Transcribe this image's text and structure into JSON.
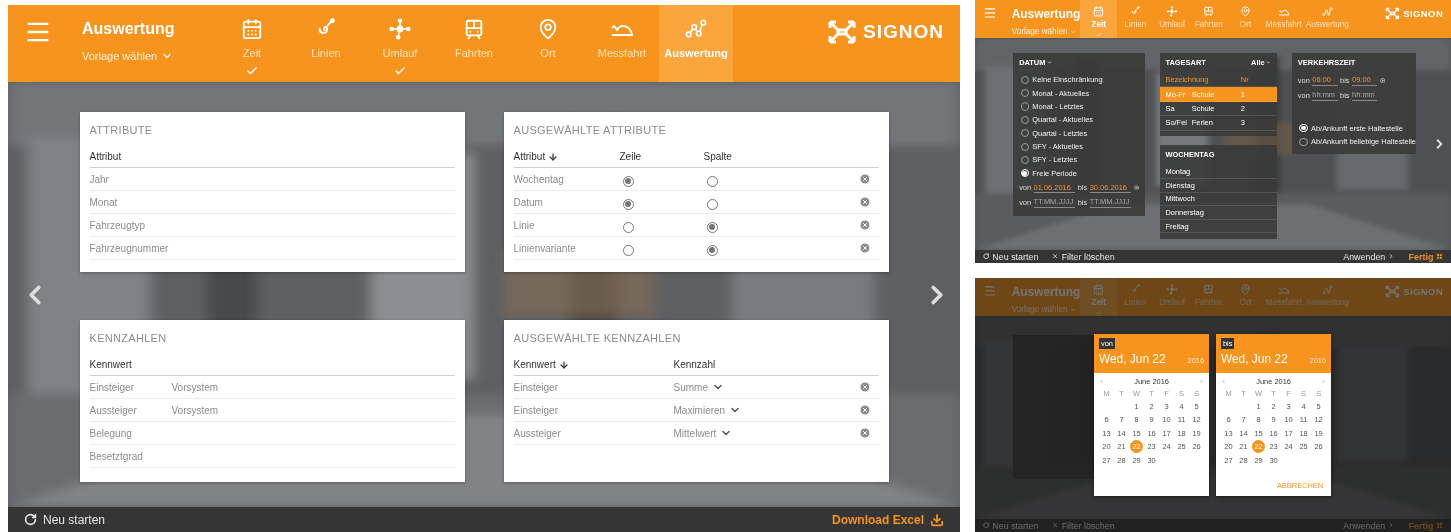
{
  "main": {
    "header": {
      "title": "Auswertung",
      "template": "Vorlage wählen",
      "logo": "SIGNON",
      "steps": [
        {
          "label": "Zeit",
          "kind": "calendar",
          "selected": false,
          "done": true
        },
        {
          "label": "Linien",
          "kind": "line",
          "selected": false,
          "done": false
        },
        {
          "label": "Umlauf",
          "kind": "network",
          "selected": false,
          "done": true
        },
        {
          "label": "Fahrten",
          "kind": "tram",
          "selected": false,
          "done": false
        },
        {
          "label": "Ort",
          "kind": "pin",
          "selected": false,
          "done": false
        },
        {
          "label": "Messfahrt",
          "kind": "hill",
          "selected": false,
          "done": false
        },
        {
          "label": "Auswertung",
          "kind": "graph",
          "selected": true,
          "done": false
        }
      ]
    },
    "attributes": {
      "title": "ATTRIBUTE",
      "column": "Attribut",
      "rows": [
        "Jahr",
        "Monat",
        "Fahrzeugtyp",
        "Fahrzeugnummer"
      ]
    },
    "selected_attributes": {
      "title": "AUSGEWÄHLTE ATTRIBUTE",
      "columns": [
        "Attribut",
        "Zeile",
        "Spalte"
      ],
      "rows": [
        {
          "name": "Wochentag",
          "zeile": true,
          "spalte": false
        },
        {
          "name": "Datum",
          "zeile": true,
          "spalte": false
        },
        {
          "name": "Linie",
          "zeile": false,
          "spalte": true
        },
        {
          "name": "Linienvariante",
          "zeile": false,
          "spalte": true
        }
      ]
    },
    "figures": {
      "title": "KENNZAHLEN",
      "column": "Kennwert",
      "rows": [
        {
          "name": "Einsteiger",
          "source": "Vorsystem"
        },
        {
          "name": "Aussteiger",
          "source": "Vorsystem"
        },
        {
          "name": "Belegung"
        },
        {
          "name": "Besetztgrad"
        }
      ]
    },
    "selected_figures": {
      "title": "AUSGEWÄHLTE KENNZAHLEN",
      "columns": [
        "Kennwert",
        "Kennzahl"
      ],
      "rows": [
        {
          "name": "Einsteiger",
          "measure": "Summe"
        },
        {
          "name": "Einsteiger",
          "measure": "Maximieren"
        },
        {
          "name": "Aussteiger",
          "measure": "Mittelwert"
        }
      ]
    },
    "footer": {
      "left": [
        {
          "label": "Neu starten",
          "kind": "restart",
          "accent": false
        }
      ],
      "right": [
        {
          "label": "Download Excel",
          "kind": "download",
          "accent": true
        }
      ]
    }
  },
  "filter_view": {
    "header": {
      "title": "Auswertung",
      "template": "Vorlage wählen",
      "logo": "SIGNON",
      "steps": [
        {
          "label": "Zeit",
          "kind": "calendar",
          "selected": true,
          "done": true
        },
        {
          "label": "Linien",
          "kind": "line",
          "selected": false,
          "done": false
        },
        {
          "label": "Umlauf",
          "kind": "network",
          "selected": false,
          "done": false
        },
        {
          "label": "Fahrten",
          "kind": "tram",
          "selected": false,
          "done": false
        },
        {
          "label": "Ort",
          "kind": "pin",
          "selected": false,
          "done": false
        },
        {
          "label": "Messfahrt",
          "kind": "hill",
          "selected": false,
          "done": false
        },
        {
          "label": "Auswertung",
          "kind": "graph",
          "selected": false,
          "done": false
        }
      ]
    },
    "datum": {
      "title": "DATUM",
      "options": [
        {
          "label": "Keine Einschränkung",
          "selected": false
        },
        {
          "label": "Monat - Aktuelles",
          "selected": false
        },
        {
          "label": "Monat - Letztes",
          "selected": false
        },
        {
          "label": "Quartal - Aktuelles",
          "selected": false
        },
        {
          "label": "Quartal - Letztes",
          "selected": false
        },
        {
          "label": "SFY - Aktuelles",
          "selected": false
        },
        {
          "label": "SFY - Letztes",
          "selected": false
        },
        {
          "label": "Freie Periode",
          "selected": true
        }
      ],
      "ranges": [
        {
          "from_label": "von",
          "from_value": "01.06.2016",
          "to_label": "bis",
          "to_value": "30.06.2016"
        },
        {
          "from_label": "von",
          "from_placeholder": "TT.MM.JJJJ",
          "to_label": "bis",
          "to_placeholder": "TT.MM.JJJJ"
        }
      ]
    },
    "tagesart": {
      "title": "TAGESART",
      "filter": "Alle",
      "columns": [
        "Bezeichnung",
        "Nr"
      ],
      "rows": [
        {
          "day": "Mo-Fr",
          "type": "Schule",
          "nr": "1",
          "selected": true
        },
        {
          "day": "Sa",
          "type": "Schule",
          "nr": "2",
          "selected": false
        },
        {
          "day": "So/Fei",
          "type": "Ferien",
          "nr": "3",
          "selected": false
        }
      ]
    },
    "wochentag": {
      "title": "WOCHENTAG",
      "rows": [
        "Montag",
        "Dienstag",
        "Mittwoch",
        "Donnerstag",
        "Freitag"
      ]
    },
    "verkehrszeit": {
      "title": "VERKEHRSZEIT",
      "ranges": [
        {
          "from_label": "von",
          "from_value": "06:00",
          "to_label": "bis",
          "to_value": "09:00"
        },
        {
          "from_label": "von",
          "from_placeholder": "hh:mm",
          "to_label": "bis",
          "to_placeholder": "hh:mm"
        }
      ],
      "options": [
        {
          "label": "Ab/Ankunft erste Haltestelle",
          "selected": true
        },
        {
          "label": "Ab/Ankunft beliebige Haltestelle",
          "selected": false
        }
      ]
    },
    "footer": {
      "left": [
        {
          "label": "Neu starten",
          "kind": "restart",
          "accent": false
        },
        {
          "label": "Filter löschen",
          "kind": "clear",
          "accent": false
        }
      ],
      "right": [
        {
          "label": "Anwenden",
          "kind": "next",
          "accent": false
        },
        {
          "label": "Fertig",
          "kind": "done",
          "accent": true
        }
      ]
    }
  },
  "date_view": {
    "header": {
      "title": "Auswertung",
      "template": "Vorlage wählen",
      "logo": "SIGNON",
      "steps": [
        {
          "label": "Zeit",
          "kind": "calendar",
          "selected": true,
          "done": true
        },
        {
          "label": "Linien",
          "kind": "line",
          "selected": false,
          "done": false
        },
        {
          "label": "Umlauf",
          "kind": "network",
          "selected": false,
          "done": false
        },
        {
          "label": "Fahrten",
          "kind": "tram",
          "selected": false,
          "done": false
        },
        {
          "label": "Ort",
          "kind": "pin",
          "selected": false,
          "done": false
        },
        {
          "label": "Messfahrt",
          "kind": "hill",
          "selected": false,
          "done": false
        },
        {
          "label": "Auswertung",
          "kind": "graph",
          "selected": false,
          "done": false
        }
      ]
    },
    "pickers": [
      {
        "tag": "von",
        "date": "Wed, Jun 22",
        "year": "2016",
        "month": "June 2016",
        "weekdays": [
          "M",
          "T",
          "W",
          "T",
          "F",
          "S",
          "S"
        ],
        "weeks": [
          [
            {
              "d": "1",
              "selected": false
            },
            {
              "d": "2",
              "selected": false
            },
            {
              "d": "3",
              "selected": false
            },
            {
              "d": "4",
              "selected": false
            },
            {
              "d": "5",
              "selected": false
            }
          ],
          [
            {
              "d": "6",
              "selected": false
            },
            {
              "d": "7",
              "selected": false
            },
            {
              "d": "8",
              "selected": false
            },
            {
              "d": "9",
              "selected": false
            },
            {
              "d": "10",
              "selected": false
            },
            {
              "d": "11",
              "selected": false
            },
            {
              "d": "12",
              "selected": false
            }
          ],
          [
            {
              "d": "13",
              "selected": false
            },
            {
              "d": "14",
              "selected": false
            },
            {
              "d": "15",
              "selected": false
            },
            {
              "d": "16",
              "selected": false
            },
            {
              "d": "17",
              "selected": false
            },
            {
              "d": "18",
              "selected": false
            },
            {
              "d": "19",
              "selected": false
            }
          ],
          [
            {
              "d": "20",
              "selected": false
            },
            {
              "d": "21",
              "selected": false
            },
            {
              "d": "22",
              "selected": true
            },
            {
              "d": "23",
              "selected": false
            },
            {
              "d": "24",
              "selected": false
            },
            {
              "d": "25",
              "selected": false
            },
            {
              "d": "26",
              "selected": false
            }
          ],
          [
            {
              "d": "27",
              "selected": false
            },
            {
              "d": "28",
              "selected": false
            },
            {
              "d": "29",
              "selected": false
            },
            {
              "d": "30",
              "selected": false
            }
          ]
        ]
      },
      {
        "tag": "bis",
        "date": "Wed, Jun 22",
        "year": "2016",
        "month": "June 2016",
        "weekdays": [
          "M",
          "T",
          "W",
          "T",
          "F",
          "S",
          "S"
        ],
        "action": "ABBRECHEN",
        "weeks": [
          [
            {
              "d": "1",
              "selected": false
            },
            {
              "d": "2",
              "selected": false
            },
            {
              "d": "3",
              "selected": false
            },
            {
              "d": "4",
              "selected": false
            },
            {
              "d": "5",
              "selected": false
            }
          ],
          [
            {
              "d": "6",
              "selected": false
            },
            {
              "d": "7",
              "selected": false
            },
            {
              "d": "8",
              "selected": false
            },
            {
              "d": "9",
              "selected": false
            },
            {
              "d": "10",
              "selected": false
            },
            {
              "d": "11",
              "selected": false
            },
            {
              "d": "12",
              "selected": false
            }
          ],
          [
            {
              "d": "13",
              "selected": false
            },
            {
              "d": "14",
              "selected": false
            },
            {
              "d": "15",
              "selected": false
            },
            {
              "d": "16",
              "selected": false
            },
            {
              "d": "17",
              "selected": false
            },
            {
              "d": "18",
              "selected": false
            },
            {
              "d": "19",
              "selected": false
            }
          ],
          [
            {
              "d": "20",
              "selected": false
            },
            {
              "d": "21",
              "selected": false
            },
            {
              "d": "22",
              "selected": true
            },
            {
              "d": "23",
              "selected": false
            },
            {
              "d": "24",
              "selected": false
            },
            {
              "d": "25",
              "selected": false
            },
            {
              "d": "26",
              "selected": false
            }
          ],
          [
            {
              "d": "27",
              "selected": false
            },
            {
              "d": "28",
              "selected": false
            },
            {
              "d": "29",
              "selected": false
            },
            {
              "d": "30",
              "selected": false
            }
          ]
        ]
      }
    ],
    "footer": {
      "left": [
        {
          "label": "Neu starten",
          "kind": "restart",
          "accent": false
        },
        {
          "label": "Filter löschen",
          "kind": "clear",
          "accent": false
        }
      ],
      "right": [
        {
          "label": "Anwenden",
          "kind": "next",
          "accent": false
        },
        {
          "label": "Fertig",
          "kind": "done",
          "accent": true
        }
      ]
    }
  }
}
